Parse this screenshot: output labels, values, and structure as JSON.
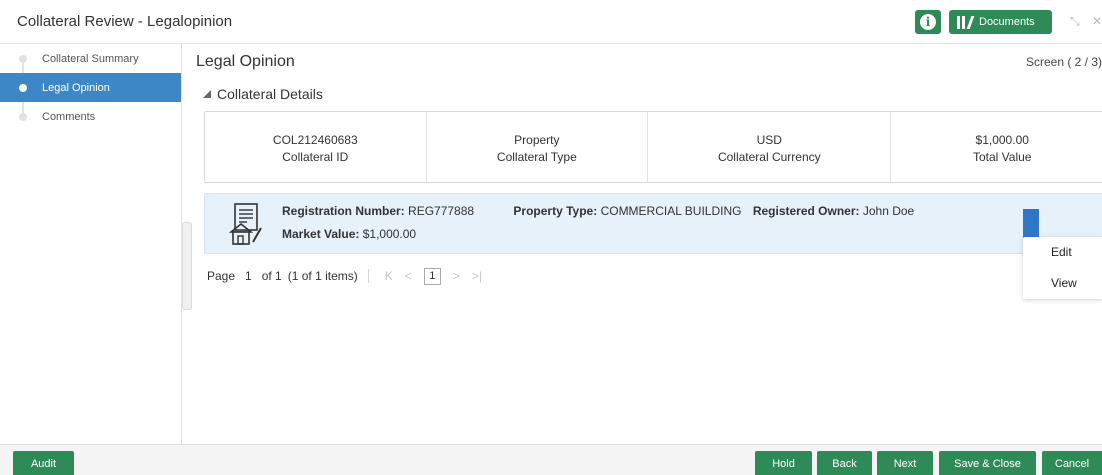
{
  "header": {
    "title": "Collateral Review - Legalopinion",
    "documents_label": "Documents",
    "info_icon": "info-icon",
    "documents_icon": "library-icon",
    "minimize_icon": "collapse-icon",
    "close_icon": "close-icon",
    "accent_color": "#2e8b57"
  },
  "sidebar": {
    "items": [
      {
        "label": "Collateral Summary",
        "active": false
      },
      {
        "label": "Legal Opinion",
        "active": true
      },
      {
        "label": "Comments",
        "active": false
      }
    ],
    "active_color": "#3e87c6"
  },
  "main": {
    "page_title": "Legal Opinion",
    "screen_indicator": "Screen ( 2 / 3)",
    "section_title": "Collateral Details",
    "summary": [
      {
        "value": "COL212460683",
        "label": "Collateral ID"
      },
      {
        "value": "Property",
        "label": "Collateral Type"
      },
      {
        "value": "USD",
        "label": "Collateral Currency"
      },
      {
        "value": "$1,000.00",
        "label": "Total Value"
      }
    ],
    "registration": {
      "reg_number_label": "Registration Number:",
      "reg_number": "REG777888",
      "property_type_label": "Property Type:",
      "property_type": "COMMERCIAL BUILDING",
      "owner_label": "Registered Owner:",
      "owner": "John Doe",
      "market_value_label": "Market Value:",
      "market_value": "$1,000.00",
      "icon": "property-document-icon"
    },
    "action_menu": [
      "Edit",
      "View"
    ],
    "pager": {
      "page_label": "Page",
      "page_number": "1",
      "of_text": "of 1",
      "items_text": "(1 of 1 items)",
      "current_page": "1"
    }
  },
  "footer": {
    "audit": "Audit",
    "hold": "Hold",
    "back": "Back",
    "next": "Next",
    "save_close": "Save & Close",
    "cancel": "Cancel"
  }
}
